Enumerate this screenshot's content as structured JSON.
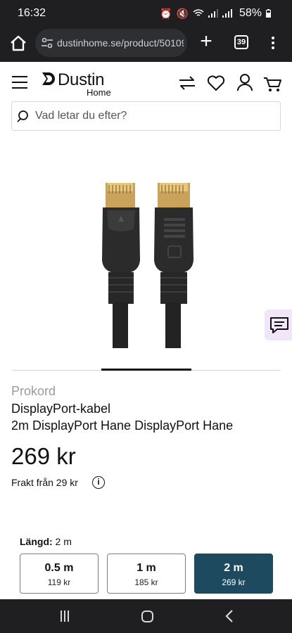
{
  "status_bar": {
    "time": "16:32",
    "battery": "58%"
  },
  "browser": {
    "url": "dustinhome.se/product/50109",
    "tab_count": "39"
  },
  "site": {
    "logo_name": "Dustin",
    "logo_sub": "Home",
    "search_placeholder": "Vad letar du efter?"
  },
  "product": {
    "brand": "Prokord",
    "title": "DisplayPort-kabel",
    "subtitle": "2m DisplayPort Hane DisplayPort Hane",
    "price": "269 kr",
    "shipping": "Frakt från 29 kr",
    "carousel": {
      "slides": 3,
      "active": 2
    }
  },
  "variant_selector": {
    "label": "Längd:",
    "selected_value": "2 m",
    "options": [
      {
        "name": "0.5 m",
        "price": "119 kr"
      },
      {
        "name": "1 m",
        "price": "185 kr"
      },
      {
        "name": "2 m",
        "price": "269 kr"
      }
    ]
  },
  "colors": {
    "accent": "#1e4a60",
    "chat_bg": "#f1e6f7",
    "system_bar": "#1f1f22"
  }
}
